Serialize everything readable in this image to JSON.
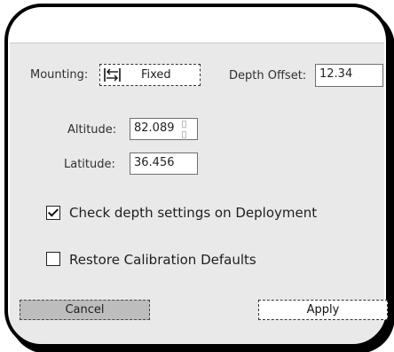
{
  "mounting": {
    "label": "Mounting:",
    "value": "Fixed",
    "icon": "mount-arrows-icon"
  },
  "depth_offset": {
    "label": "Depth Offset:",
    "value": "12.34"
  },
  "altitude": {
    "label": "Altitude:",
    "value": "82.089"
  },
  "latitude": {
    "label": "Latitude:",
    "value": "36.456"
  },
  "checks": [
    {
      "label": "Check depth settings on Deployment",
      "checked": true
    },
    {
      "label": "Restore Calibration Defaults",
      "checked": false
    }
  ],
  "buttons": {
    "cancel": "Cancel",
    "apply": "Apply"
  }
}
